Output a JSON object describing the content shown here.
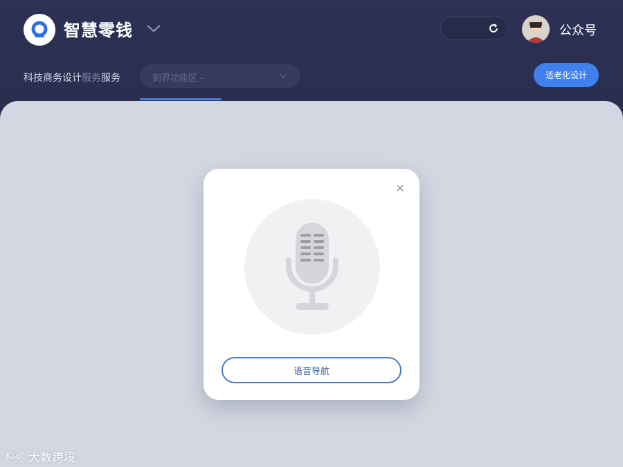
{
  "header": {
    "app_title": "智慧零钱",
    "account_label": "公众号",
    "icons": [
      "app-logo-icon",
      "chevron-down-icon",
      "refresh-icon",
      "avatar"
    ]
  },
  "nav": {
    "label_main": "科技商务设计",
    "label_blur": "服务",
    "label_tail": "服务",
    "dropdown_text": "到界功能区 -",
    "senior_mode_button": "适老化设计"
  },
  "dialog": {
    "voice_nav_button": "语音导航",
    "icons": [
      "close-icon",
      "microphone-icon"
    ]
  },
  "watermark": {
    "logo_text": "Kᴗo°",
    "text": "大数跨境"
  },
  "colors": {
    "header_bg": "#2c3155",
    "content_bg": "#d3d7e1",
    "accent": "#3f80ee",
    "button_border": "#4a78c8"
  }
}
